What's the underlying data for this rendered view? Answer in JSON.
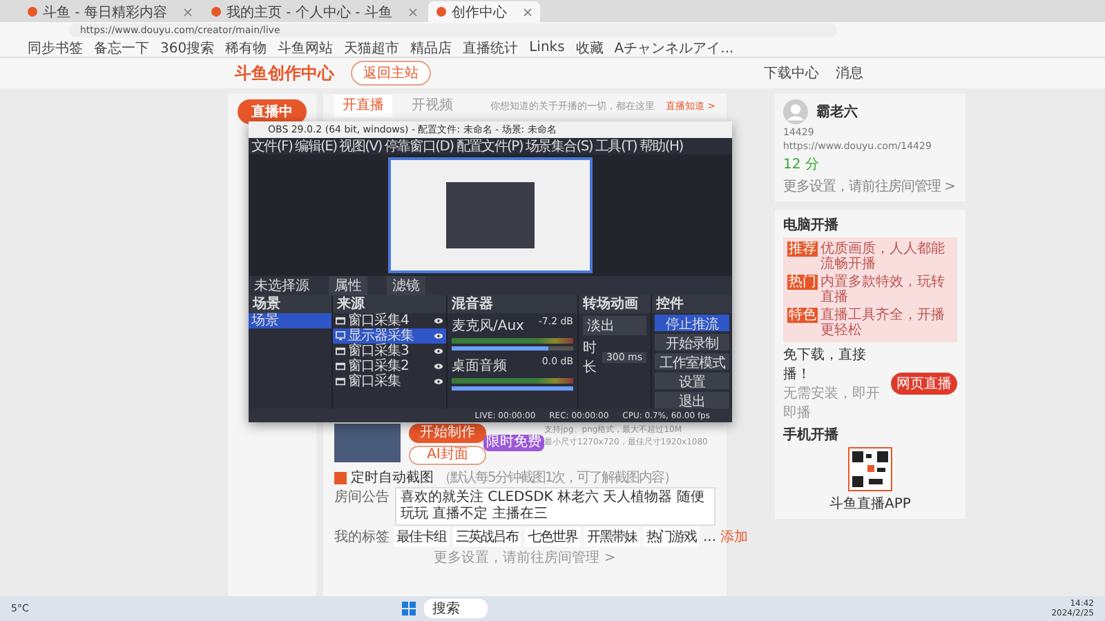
{
  "browser": {
    "tabs": [
      {
        "title": "斗鱼 - 每日精彩内容",
        "selected": false
      },
      {
        "title": "我的主页 - 个人中心 - 斗鱼",
        "selected": false
      },
      {
        "title": "创作中心",
        "selected": true
      }
    ],
    "url": "https://www.douyu.com/creator/main/live",
    "bookmarks": [
      "同步书签",
      "备忘一下",
      "360搜索",
      "稀有物",
      "斗鱼网站",
      "天猫超市",
      "精品店",
      "直播统计",
      "Links",
      "收藏",
      "Aチャンネルアイ..."
    ]
  },
  "header": {
    "logo": "斗鱼创作中心",
    "back_button": "返回主站",
    "download": "下载中心",
    "messages": "消息"
  },
  "sidebar": {
    "live_button": "直播中"
  },
  "main": {
    "tabs": [
      {
        "label": "开直播",
        "selected": true
      },
      {
        "label": "开视频",
        "selected": false
      }
    ],
    "notice": "你想知道的关于开播的一切，都在这里",
    "notice_link": "直播知道 >",
    "make_button": "开始制作",
    "ai_button": "AI封面",
    "ai_badge": "限时免费",
    "cover_hints": [
      "支持jpg、png格式，最大不超过10M",
      "最小尺寸1270x720，最佳尺寸1920x1080"
    ],
    "auto_capture": {
      "label": "定时自动截图",
      "hint": "（默认每5分钟截图1次，可了解截图内容）",
      "checked": true
    },
    "announcement_label": "房间公告",
    "announcement": "喜欢的就关注 CLEDSDK 林老六 天人植物器 随便玩玩 直播不定 主播在三",
    "tags_label": "我的标签",
    "tags": [
      "最佳卡组",
      "三英战吕布",
      "七色世界",
      "开黑带妹",
      "热门游戏"
    ],
    "tags_more": "...",
    "tags_add": "添加",
    "footer": "更多设置，请前往房间管理 >"
  },
  "profile": {
    "name": "霸老六",
    "room": "14429",
    "link": "https://www.douyu.com/14429",
    "score": "12 分",
    "footer": "更多设置，请前往房间管理 >"
  },
  "pc_live": {
    "title": "电脑开播",
    "items": [
      {
        "tag": "推荐",
        "text": "优质画质，人人都能流畅开播"
      },
      {
        "tag": "热门",
        "text": "内置多款特效，玩转直播"
      },
      {
        "tag": "特色",
        "text": "直播工具齐全，开播更轻松"
      }
    ],
    "web_title": "免下载，直接播！",
    "web_text": "无需安装，即开即播",
    "web_button": "网页直播"
  },
  "mobile_live": {
    "title": "手机开播",
    "qr_caption": "斗鱼直播APP"
  },
  "obs": {
    "title": "OBS 29.0.2 (64 bit, windows) - 配置文件: 未命名 - 场景: 未命名",
    "menu": [
      "文件(F)",
      "编辑(E)",
      "视图(V)",
      "停靠窗口(D)",
      "配置文件(P)",
      "场景集合(S)",
      "工具(T)",
      "帮助(H)"
    ],
    "no_source": "未选择源",
    "properties": "属性",
    "filters": "滤镜",
    "docks": {
      "scenes": "场景",
      "sources": "来源",
      "mixer": "混音器",
      "transitions": "转场动画",
      "controls": "控件"
    },
    "scenes": [
      {
        "name": "场景",
        "selected": true
      }
    ],
    "sources": [
      {
        "name": "窗口采集4",
        "kind": "window",
        "selected": false
      },
      {
        "name": "显示器采集",
        "kind": "monitor",
        "selected": true
      },
      {
        "name": "窗口采集3",
        "kind": "window",
        "selected": false
      },
      {
        "name": "窗口采集2",
        "kind": "window",
        "selected": false
      },
      {
        "name": "窗口采集",
        "kind": "window",
        "selected": false
      }
    ],
    "mixer": [
      {
        "name": "麦克风/Aux",
        "reading": "-7.2 dB",
        "level": 0.8
      },
      {
        "name": "桌面音频",
        "reading": "0.0 dB",
        "level": 1
      }
    ],
    "transition": "淡出",
    "duration_label": "时长",
    "duration": "300 ms",
    "controls": [
      {
        "label": "停止推流",
        "selected": true
      },
      {
        "label": "开始录制",
        "selected": false
      },
      {
        "label": "工作室模式",
        "selected": false
      },
      {
        "label": "设置",
        "selected": false
      },
      {
        "label": "退出",
        "selected": false
      }
    ],
    "status": {
      "live": "LIVE: 00:00:00",
      "rec": "REC: 00:00:00",
      "cpu": "CPU: 0.7%, 60.00 fps"
    }
  },
  "taskbar": {
    "weather": "5°C",
    "search": "搜索",
    "time": "14:42",
    "date": "2024/2/25"
  }
}
